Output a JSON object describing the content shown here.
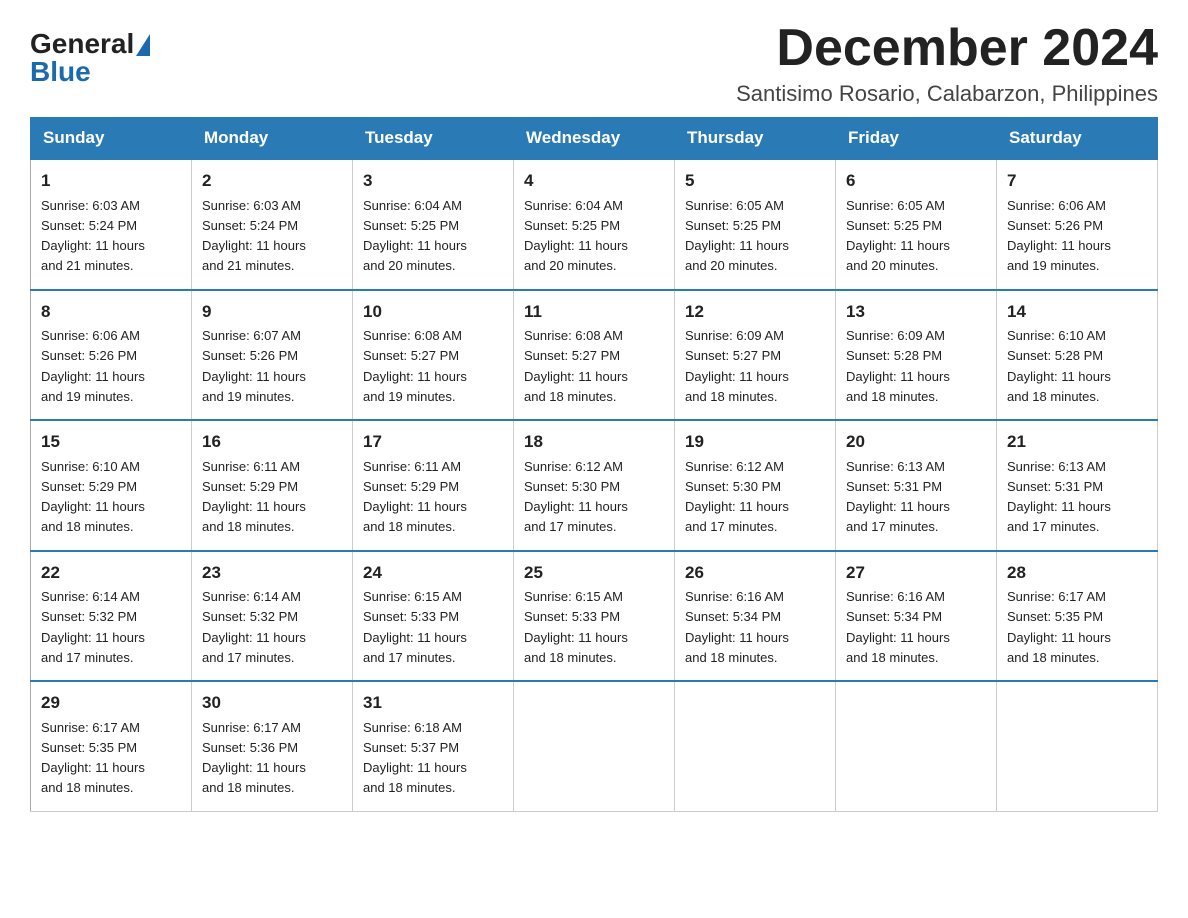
{
  "header": {
    "logo_general": "General",
    "logo_blue": "Blue",
    "title": "December 2024",
    "subtitle": "Santisimo Rosario, Calabarzon, Philippines"
  },
  "days_of_week": [
    "Sunday",
    "Monday",
    "Tuesday",
    "Wednesday",
    "Thursday",
    "Friday",
    "Saturday"
  ],
  "weeks": [
    [
      {
        "day": "1",
        "sunrise": "6:03 AM",
        "sunset": "5:24 PM",
        "daylight": "11 hours and 21 minutes."
      },
      {
        "day": "2",
        "sunrise": "6:03 AM",
        "sunset": "5:24 PM",
        "daylight": "11 hours and 21 minutes."
      },
      {
        "day": "3",
        "sunrise": "6:04 AM",
        "sunset": "5:25 PM",
        "daylight": "11 hours and 20 minutes."
      },
      {
        "day": "4",
        "sunrise": "6:04 AM",
        "sunset": "5:25 PM",
        "daylight": "11 hours and 20 minutes."
      },
      {
        "day": "5",
        "sunrise": "6:05 AM",
        "sunset": "5:25 PM",
        "daylight": "11 hours and 20 minutes."
      },
      {
        "day": "6",
        "sunrise": "6:05 AM",
        "sunset": "5:25 PM",
        "daylight": "11 hours and 20 minutes."
      },
      {
        "day": "7",
        "sunrise": "6:06 AM",
        "sunset": "5:26 PM",
        "daylight": "11 hours and 19 minutes."
      }
    ],
    [
      {
        "day": "8",
        "sunrise": "6:06 AM",
        "sunset": "5:26 PM",
        "daylight": "11 hours and 19 minutes."
      },
      {
        "day": "9",
        "sunrise": "6:07 AM",
        "sunset": "5:26 PM",
        "daylight": "11 hours and 19 minutes."
      },
      {
        "day": "10",
        "sunrise": "6:08 AM",
        "sunset": "5:27 PM",
        "daylight": "11 hours and 19 minutes."
      },
      {
        "day": "11",
        "sunrise": "6:08 AM",
        "sunset": "5:27 PM",
        "daylight": "11 hours and 18 minutes."
      },
      {
        "day": "12",
        "sunrise": "6:09 AM",
        "sunset": "5:27 PM",
        "daylight": "11 hours and 18 minutes."
      },
      {
        "day": "13",
        "sunrise": "6:09 AM",
        "sunset": "5:28 PM",
        "daylight": "11 hours and 18 minutes."
      },
      {
        "day": "14",
        "sunrise": "6:10 AM",
        "sunset": "5:28 PM",
        "daylight": "11 hours and 18 minutes."
      }
    ],
    [
      {
        "day": "15",
        "sunrise": "6:10 AM",
        "sunset": "5:29 PM",
        "daylight": "11 hours and 18 minutes."
      },
      {
        "day": "16",
        "sunrise": "6:11 AM",
        "sunset": "5:29 PM",
        "daylight": "11 hours and 18 minutes."
      },
      {
        "day": "17",
        "sunrise": "6:11 AM",
        "sunset": "5:29 PM",
        "daylight": "11 hours and 18 minutes."
      },
      {
        "day": "18",
        "sunrise": "6:12 AM",
        "sunset": "5:30 PM",
        "daylight": "11 hours and 17 minutes."
      },
      {
        "day": "19",
        "sunrise": "6:12 AM",
        "sunset": "5:30 PM",
        "daylight": "11 hours and 17 minutes."
      },
      {
        "day": "20",
        "sunrise": "6:13 AM",
        "sunset": "5:31 PM",
        "daylight": "11 hours and 17 minutes."
      },
      {
        "day": "21",
        "sunrise": "6:13 AM",
        "sunset": "5:31 PM",
        "daylight": "11 hours and 17 minutes."
      }
    ],
    [
      {
        "day": "22",
        "sunrise": "6:14 AM",
        "sunset": "5:32 PM",
        "daylight": "11 hours and 17 minutes."
      },
      {
        "day": "23",
        "sunrise": "6:14 AM",
        "sunset": "5:32 PM",
        "daylight": "11 hours and 17 minutes."
      },
      {
        "day": "24",
        "sunrise": "6:15 AM",
        "sunset": "5:33 PM",
        "daylight": "11 hours and 17 minutes."
      },
      {
        "day": "25",
        "sunrise": "6:15 AM",
        "sunset": "5:33 PM",
        "daylight": "11 hours and 18 minutes."
      },
      {
        "day": "26",
        "sunrise": "6:16 AM",
        "sunset": "5:34 PM",
        "daylight": "11 hours and 18 minutes."
      },
      {
        "day": "27",
        "sunrise": "6:16 AM",
        "sunset": "5:34 PM",
        "daylight": "11 hours and 18 minutes."
      },
      {
        "day": "28",
        "sunrise": "6:17 AM",
        "sunset": "5:35 PM",
        "daylight": "11 hours and 18 minutes."
      }
    ],
    [
      {
        "day": "29",
        "sunrise": "6:17 AM",
        "sunset": "5:35 PM",
        "daylight": "11 hours and 18 minutes."
      },
      {
        "day": "30",
        "sunrise": "6:17 AM",
        "sunset": "5:36 PM",
        "daylight": "11 hours and 18 minutes."
      },
      {
        "day": "31",
        "sunrise": "6:18 AM",
        "sunset": "5:37 PM",
        "daylight": "11 hours and 18 minutes."
      },
      null,
      null,
      null,
      null
    ]
  ],
  "labels": {
    "sunrise": "Sunrise:",
    "sunset": "Sunset:",
    "daylight": "Daylight:"
  }
}
